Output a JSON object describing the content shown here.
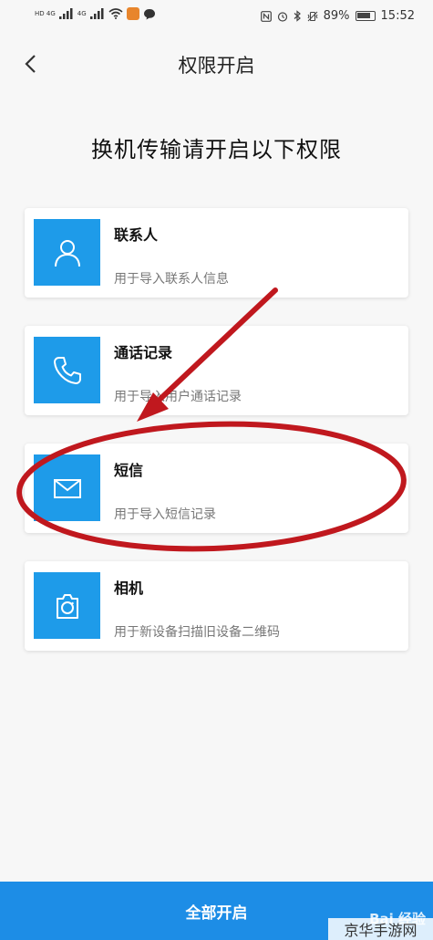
{
  "status_bar": {
    "sim1": "HD 4G",
    "sim2": "4G",
    "battery": "89%",
    "time": "15:52"
  },
  "header": {
    "title": "权限开启"
  },
  "headline": "换机传输请开启以下权限",
  "permissions": [
    {
      "icon": "person-icon",
      "title": "联系人",
      "desc": "用于导入联系人信息"
    },
    {
      "icon": "phone-icon",
      "title": "通话记录",
      "desc": "用于导入用户通话记录"
    },
    {
      "icon": "mail-icon",
      "title": "短信",
      "desc": "用于导入短信记录"
    },
    {
      "icon": "camera-icon",
      "title": "相机",
      "desc": "用于新设备扫描旧设备二维码"
    }
  ],
  "bottom_button": {
    "label": "全部开启"
  },
  "watermark": {
    "text": "Bai 经验",
    "corner_text": "京华手游网"
  },
  "colors": {
    "accent": "#1d8de6",
    "icon_bg": "#1e9be9",
    "annotation": "#c0181e"
  }
}
